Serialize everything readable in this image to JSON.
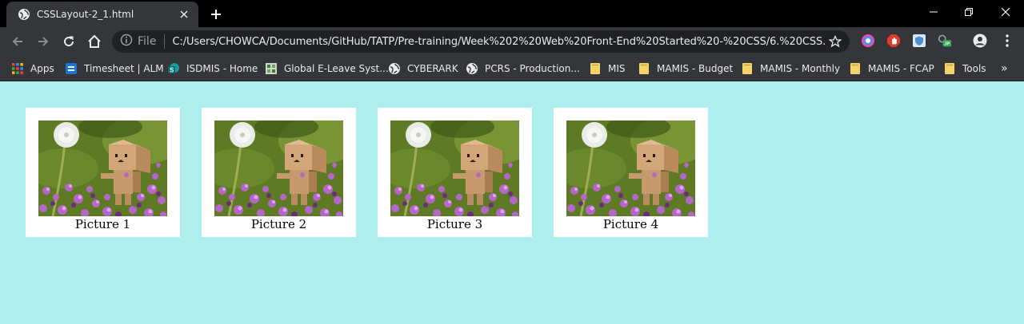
{
  "browser": {
    "tab": {
      "title": "CSSLayout-2_1.html"
    },
    "address_bar": {
      "site_info_label": "File",
      "url": "C:/Users/CHOWCA/Documents/GitHub/TATP/Pre-training/Week%202%20Web%20Front-End%20Started%20-%20CSS/6.%20CSS..."
    },
    "bookmarks": [
      {
        "label": "Apps",
        "icon": "apps-grid-icon"
      },
      {
        "label": "Timesheet | ALM",
        "icon": "alm-icon"
      },
      {
        "label": "ISDMIS - Home",
        "icon": "sharepoint-icon"
      },
      {
        "label": "Global E-Leave Syst...",
        "icon": "eleave-icon"
      },
      {
        "label": "CYBERARK",
        "icon": "globe-icon"
      },
      {
        "label": "PCRS - Production...",
        "icon": "globe-icon"
      },
      {
        "label": "MIS",
        "icon": "folder-icon"
      },
      {
        "label": "MAMIS - Budget",
        "icon": "folder-icon"
      },
      {
        "label": "MAMIS - Monthly",
        "icon": "folder-icon"
      },
      {
        "label": "MAMIS - FCAP",
        "icon": "folder-icon"
      },
      {
        "label": "Tools",
        "icon": "folder-icon"
      }
    ],
    "bookmarks_overflow": "»"
  },
  "page": {
    "background_color": "#afeeee",
    "gallery": [
      {
        "caption": "Picture 1"
      },
      {
        "caption": "Picture 2"
      },
      {
        "caption": "Picture 3"
      },
      {
        "caption": "Picture 4"
      }
    ]
  }
}
